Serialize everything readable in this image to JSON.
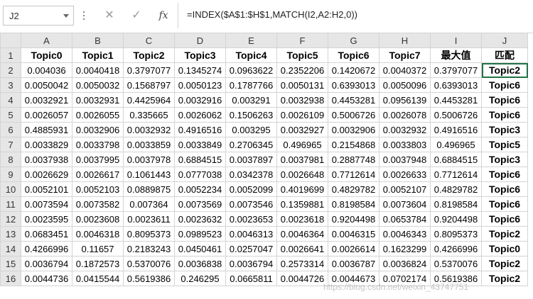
{
  "name_box": "J2",
  "formula_icon": "fx",
  "formula": "=INDEX($A$1:$H$1,MATCH(I2,A2:H2,0))",
  "columns": [
    "A",
    "B",
    "C",
    "D",
    "E",
    "F",
    "G",
    "H",
    "I",
    "J"
  ],
  "rows": [
    [
      "Topic0",
      "Topic1",
      "Topic2",
      "Topic3",
      "Topic4",
      "Topic5",
      "Topic6",
      "Topic7",
      "最大值",
      "匹配"
    ],
    [
      "0.004036",
      "0.0040418",
      "0.3797077",
      "0.1345274",
      "0.0963622",
      "0.2352206",
      "0.1420672",
      "0.0040372",
      "0.3797077",
      "Topic2"
    ],
    [
      "0.0050042",
      "0.0050032",
      "0.1568797",
      "0.0050123",
      "0.1787766",
      "0.0050131",
      "0.6393013",
      "0.0050096",
      "0.6393013",
      "Topic6"
    ],
    [
      "0.0032921",
      "0.0032931",
      "0.4425964",
      "0.0032916",
      "0.003291",
      "0.0032938",
      "0.4453281",
      "0.0956139",
      "0.4453281",
      "Topic6"
    ],
    [
      "0.0026057",
      "0.0026055",
      "0.335665",
      "0.0026062",
      "0.1506263",
      "0.0026109",
      "0.5006726",
      "0.0026078",
      "0.5006726",
      "Topic6"
    ],
    [
      "0.4885931",
      "0.0032906",
      "0.0032932",
      "0.4916516",
      "0.003295",
      "0.0032927",
      "0.0032906",
      "0.0032932",
      "0.4916516",
      "Topic3"
    ],
    [
      "0.0033829",
      "0.0033798",
      "0.0033859",
      "0.0033849",
      "0.2706345",
      "0.496965",
      "0.2154868",
      "0.0033803",
      "0.496965",
      "Topic5"
    ],
    [
      "0.0037938",
      "0.0037995",
      "0.0037978",
      "0.6884515",
      "0.0037897",
      "0.0037981",
      "0.2887748",
      "0.0037948",
      "0.6884515",
      "Topic3"
    ],
    [
      "0.0026629",
      "0.0026617",
      "0.1061443",
      "0.0777038",
      "0.0342378",
      "0.0026648",
      "0.7712614",
      "0.0026633",
      "0.7712614",
      "Topic6"
    ],
    [
      "0.0052101",
      "0.0052103",
      "0.0889875",
      "0.0052234",
      "0.0052099",
      "0.4019699",
      "0.4829782",
      "0.0052107",
      "0.4829782",
      "Topic6"
    ],
    [
      "0.0073594",
      "0.0073582",
      "0.007364",
      "0.0073569",
      "0.0073546",
      "0.1359881",
      "0.8198584",
      "0.0073604",
      "0.8198584",
      "Topic6"
    ],
    [
      "0.0023595",
      "0.0023608",
      "0.0023611",
      "0.0023632",
      "0.0023653",
      "0.0023618",
      "0.9204498",
      "0.0653784",
      "0.9204498",
      "Topic6"
    ],
    [
      "0.0683451",
      "0.0046318",
      "0.8095373",
      "0.0989523",
      "0.0046313",
      "0.0046364",
      "0.0046315",
      "0.0046343",
      "0.8095373",
      "Topic2"
    ],
    [
      "0.4266996",
      "0.11657",
      "0.2183243",
      "0.0450461",
      "0.0257047",
      "0.0026641",
      "0.0026614",
      "0.1623299",
      "0.4266996",
      "Topic0"
    ],
    [
      "0.0036794",
      "0.1872573",
      "0.5370076",
      "0.0036838",
      "0.0036794",
      "0.2573314",
      "0.0036787",
      "0.0036824",
      "0.5370076",
      "Topic2"
    ],
    [
      "0.0044736",
      "0.0415544",
      "0.5619386",
      "0.246295",
      "0.0665811",
      "0.0044726",
      "0.0044673",
      "0.0702174",
      "0.5619386",
      "Topic2"
    ]
  ],
  "watermark": "https://blog.csdn.net/weixin_43747751"
}
